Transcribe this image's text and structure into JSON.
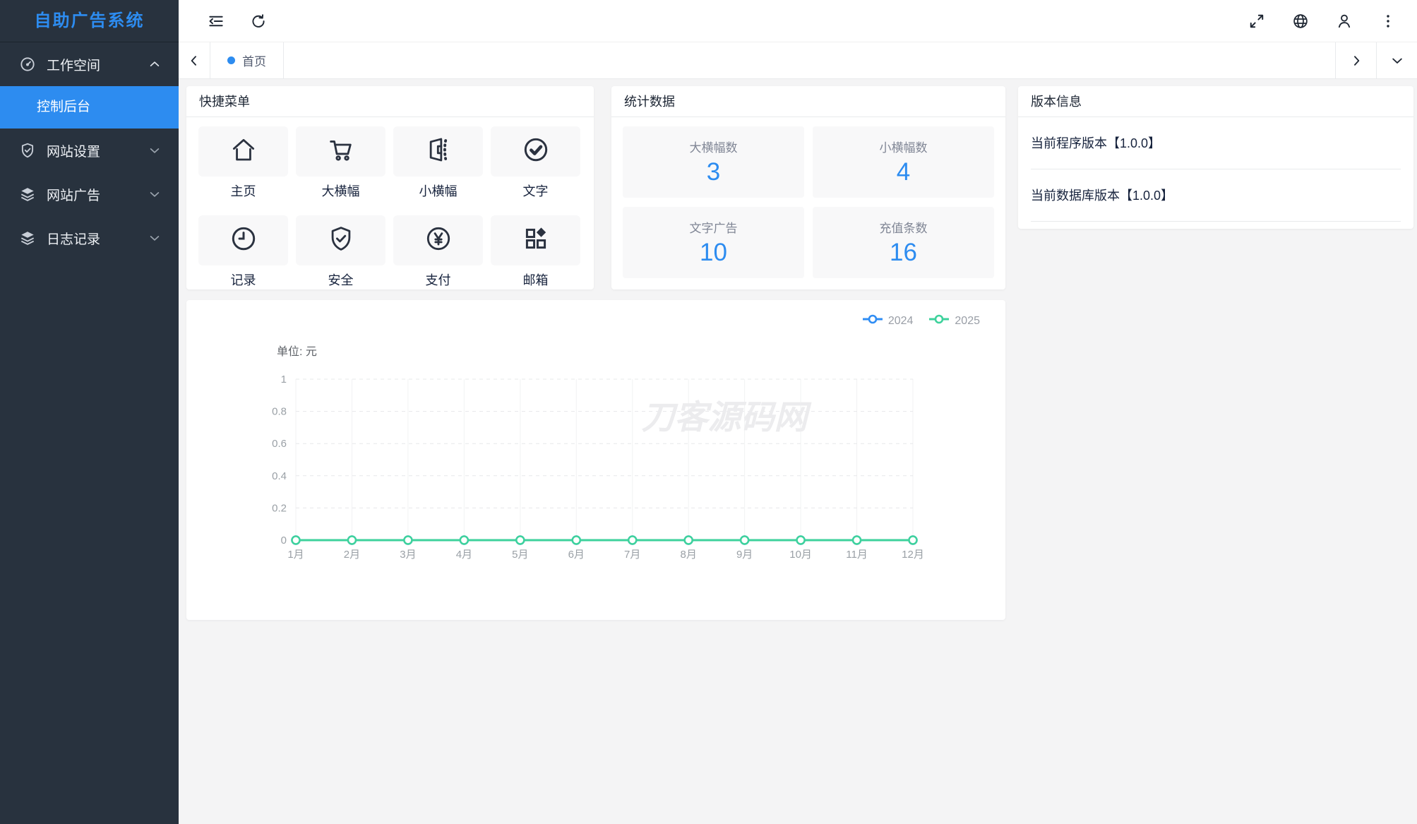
{
  "app": {
    "title": "自助广告系统"
  },
  "colors": {
    "accent": "#2d8cf0",
    "series_2024": "#2f8df4",
    "series_2025": "#3ed29c",
    "sidebar_bg": "#28323e"
  },
  "sidebar": {
    "items": [
      {
        "label": "工作空间",
        "icon": "gauge-icon",
        "expanded": true,
        "children": [
          {
            "label": "控制后台",
            "active": true
          }
        ]
      },
      {
        "label": "网站设置",
        "icon": "shield-check-icon",
        "expanded": false
      },
      {
        "label": "网站广告",
        "icon": "layers-icon",
        "expanded": false
      },
      {
        "label": "日志记录",
        "icon": "layers-icon",
        "expanded": false
      }
    ]
  },
  "tabs": {
    "items": [
      {
        "label": "首页",
        "active": true
      }
    ]
  },
  "quick_menu": {
    "title": "快捷菜单",
    "items": [
      {
        "label": "主页",
        "icon": "home-icon"
      },
      {
        "label": "大横幅",
        "icon": "cart-icon"
      },
      {
        "label": "小横幅",
        "icon": "banner-icon"
      },
      {
        "label": "文字",
        "icon": "check-circle-icon"
      },
      {
        "label": "记录",
        "icon": "clock-icon"
      },
      {
        "label": "安全",
        "icon": "shield-icon"
      },
      {
        "label": "支付",
        "icon": "yen-circle-icon"
      },
      {
        "label": "邮箱",
        "icon": "apps-icon"
      }
    ]
  },
  "stats": {
    "title": "统计数据",
    "items": [
      {
        "label": "大横幅数",
        "value": "3"
      },
      {
        "label": "小横幅数",
        "value": "4"
      },
      {
        "label": "文字广告",
        "value": "10"
      },
      {
        "label": "充值条数",
        "value": "16"
      }
    ]
  },
  "version": {
    "title": "版本信息",
    "items": [
      "当前程序版本【1.0.0】",
      "当前数据库版本【1.0.0】"
    ]
  },
  "chart_data": {
    "type": "line",
    "unit_label": "单位: 元",
    "watermark": "刀客源码网",
    "categories": [
      "1月",
      "2月",
      "3月",
      "4月",
      "5月",
      "6月",
      "7月",
      "8月",
      "9月",
      "10月",
      "11月",
      "12月"
    ],
    "series": [
      {
        "name": "2024",
        "color": "#2f8df4",
        "values": [
          0,
          0,
          0,
          0,
          0,
          0,
          0,
          0,
          0,
          0,
          0,
          0
        ]
      },
      {
        "name": "2025",
        "color": "#3ed29c",
        "values": [
          0,
          0,
          0,
          0,
          0,
          0,
          0,
          0,
          0,
          0,
          0,
          0
        ]
      }
    ],
    "ylim": [
      0,
      1
    ],
    "yticks": [
      "0",
      "0.2",
      "0.4",
      "0.6",
      "0.8",
      "1"
    ],
    "grid": true,
    "legend_position": "top-right"
  }
}
